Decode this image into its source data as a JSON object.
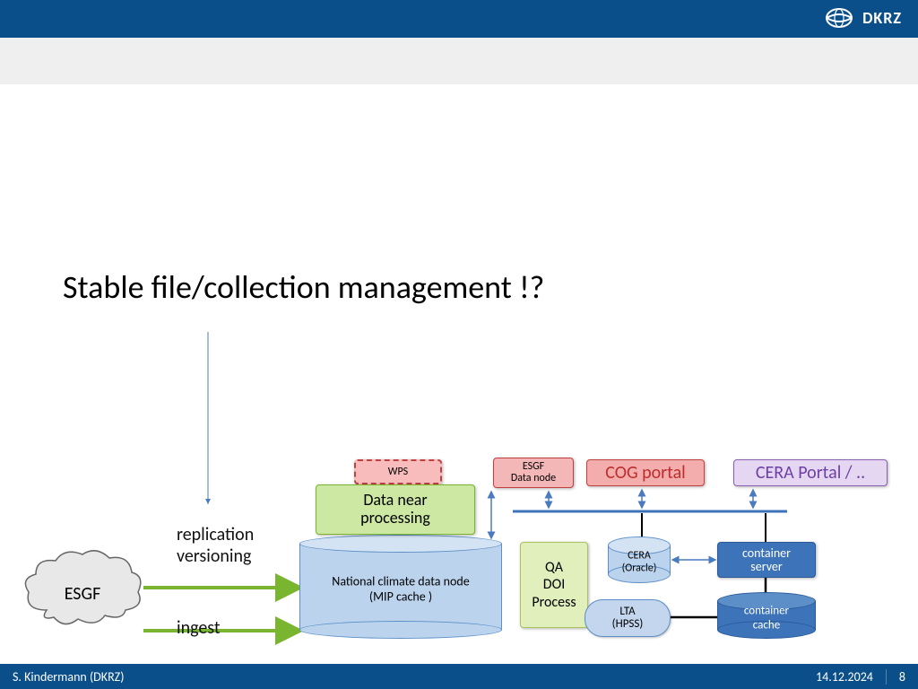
{
  "header": {
    "org": "DKRZ"
  },
  "title": "Stable file/collection management !?",
  "labels": {
    "replication": "replication",
    "versioning": "versioning",
    "ingest": "ingest"
  },
  "nodes": {
    "esgf_cloud": "ESGF",
    "wps": "WPS",
    "datanear_l1": "Data near",
    "datanear_l2": "processing",
    "national_l1": "National climate data node",
    "national_l2": "(MIP cache )",
    "esgfnode_l1": "ESGF",
    "esgfnode_l2": "Data node",
    "cog": "COG portal",
    "ceraportal": "CERA Portal / ..",
    "qa_l1": "QA",
    "qa_l2": "DOI",
    "qa_l3": "Process",
    "cera_l1": "CERA",
    "cera_l2": "(Oracle)",
    "lta_l1": "LTA",
    "lta_l2": "(HPSS)",
    "contsrv_l1": "container",
    "contsrv_l2": "server",
    "contcache_l1": "container",
    "contcache_l2": "cache"
  },
  "footer": {
    "author": "S. Kindermann (DKRZ)",
    "date": "14.12.2024",
    "page": "8"
  }
}
